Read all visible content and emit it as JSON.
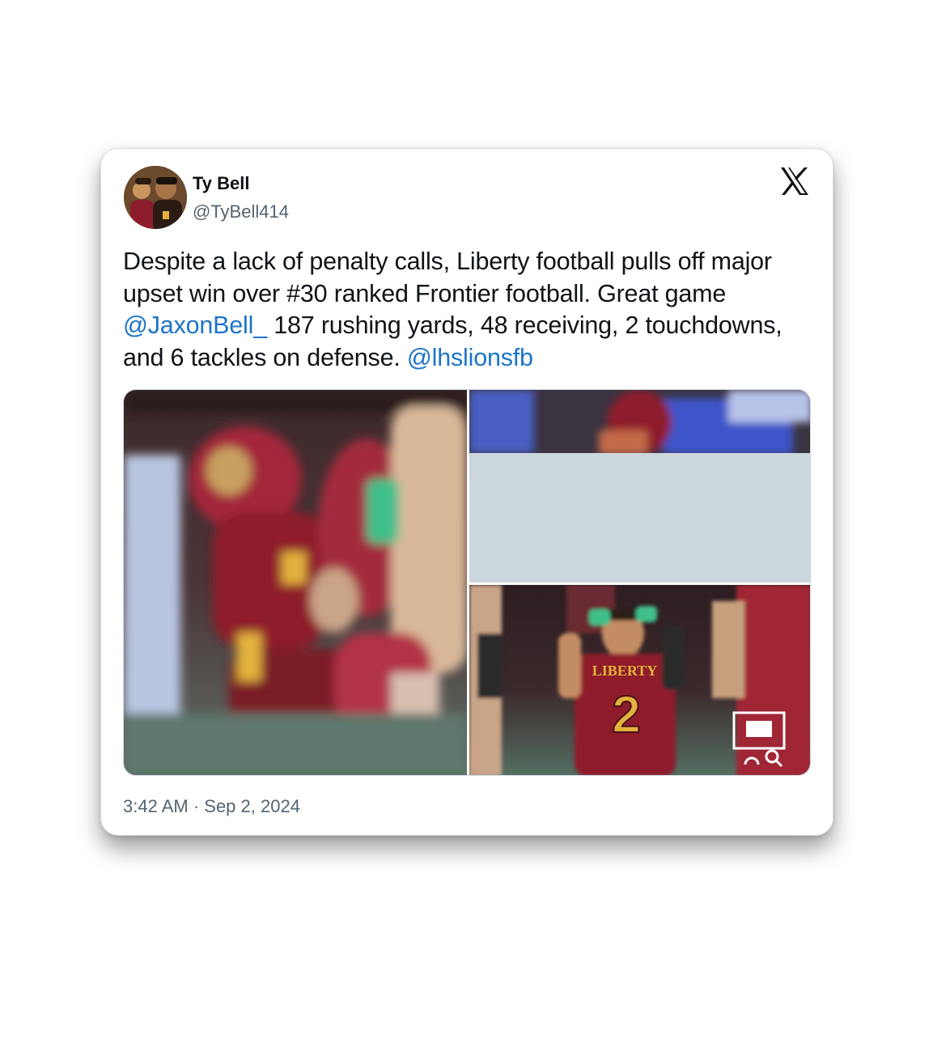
{
  "tweet": {
    "author_name": "Ty Bell",
    "author_handle": "@TyBell414",
    "text_part1": "Despite a lack of penalty calls, Liberty football pulls off major upset win over #30 ranked Frontier football. Great game ",
    "mention1": "@JaxonBell_",
    "text_part2": " 187 rushing yards, 48 receiving, 2 touchdowns, and 6 tackles on defense. ",
    "mention2": "@lhslionsfb",
    "timestamp": "3:42 AM · Sep 2, 2024"
  },
  "media": {
    "jersey_text": "LIBERTY",
    "jersey_number": "2",
    "left_jersey_number": "2"
  },
  "icons": {
    "brand": "x-logo-icon",
    "zoom": "zoom-icon"
  },
  "colors": {
    "link": "#1d74c9",
    "text": "#0f1419",
    "secondary": "#536471",
    "jersey": "#8e1d2c",
    "jersey_gold": "#e3b23c"
  }
}
